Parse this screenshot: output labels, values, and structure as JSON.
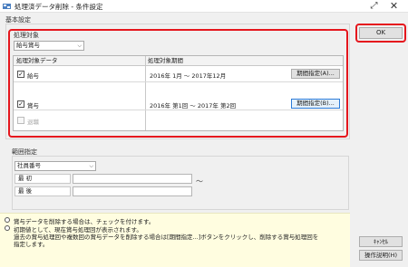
{
  "window": {
    "title": "処理済データ削除 - 条件設定",
    "icon": "app-icon"
  },
  "basic": {
    "group_label": "基本設定",
    "target_label": "処理対象",
    "target_value": "給与賞与",
    "grid": {
      "col_data": "処理対象データ",
      "col_period": "処理対象期間",
      "rows": [
        {
          "label": "給与",
          "checked": true,
          "period": "2016年 1月 〜 2017年12月",
          "button": "期間指定(A)..."
        },
        {
          "label": "賞与",
          "checked": true,
          "period": "2016年 第1回 〜 2017年 第2回",
          "button": "期間指定(B)..."
        },
        {
          "label": "退職",
          "checked": false,
          "period": "",
          "button": ""
        }
      ]
    }
  },
  "range": {
    "group_label": "範囲指定",
    "field_value": "社員番号",
    "first_label": "最 初",
    "last_label": "最 後",
    "separator": "〜"
  },
  "notes": [
    "賞与データを削除する場合は、チェックを付けます。",
    "初期値として、現在賞与処理回が表示されます。",
    "過去の賞与処理回や複数回の賞与データを削除する場合は[期間指定...]ボタンをクリックし、削除する賞与処理回を",
    "指定します。"
  ],
  "buttons": {
    "ok": "OK",
    "cancel": "ｷｬﾝｾﾙ",
    "help": "操作説明(H)"
  },
  "highlight_color": "#e5161d"
}
